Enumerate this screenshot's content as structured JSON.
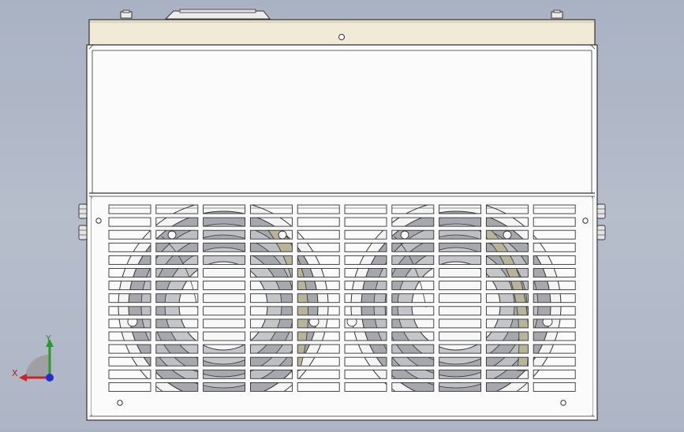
{
  "view": {
    "background_top": "#a9b2c3",
    "background_bottom": "#aeb6c6",
    "panel_color": "#fbfbfb",
    "top_band_color": "#f1ead6",
    "edge_color": "#3a3a3a",
    "fan_fill": "#a6a8ae",
    "fan_accent": "#b9b498"
  },
  "triad": {
    "x_label": "X",
    "y_label": "Y",
    "x_color": "#d42020",
    "y_color": "#20a020",
    "z_color": "#2030d0"
  },
  "grille": {
    "columns": 10,
    "rows": 15
  }
}
